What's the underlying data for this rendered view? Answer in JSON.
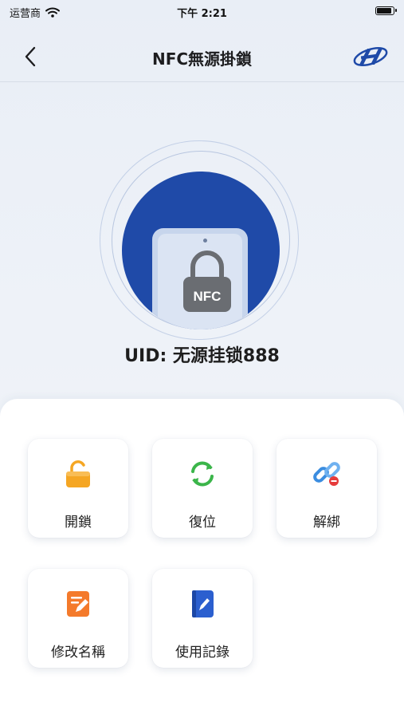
{
  "status_bar": {
    "carrier": "运营商",
    "time": "下午 2:21"
  },
  "nav": {
    "title": "NFC無源掛鎖",
    "back_icon": "chevron-left-icon",
    "logo_icon": "brand-logo-icon"
  },
  "hero": {
    "lock_text": "NFC",
    "uid": "UID: 无源挂锁888"
  },
  "actions": [
    {
      "label": "開鎖",
      "icon": "unlock-icon",
      "color": "#f5a623"
    },
    {
      "label": "復位",
      "icon": "reset-icon",
      "color": "#3bb54a"
    },
    {
      "label": "解綁",
      "icon": "unbind-link-icon",
      "color": "#3b8de0"
    },
    {
      "label": "修改名稱",
      "icon": "edit-name-icon",
      "color": "#f47a2b"
    },
    {
      "label": "使用記錄",
      "icon": "usage-record-icon",
      "color": "#2b5fcf"
    }
  ],
  "colors": {
    "primary_blue": "#1f4aa8",
    "background": "#eef2f8"
  }
}
